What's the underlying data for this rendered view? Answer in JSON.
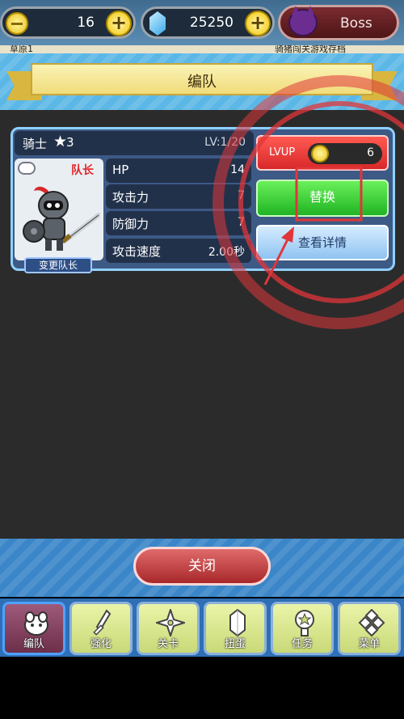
{
  "topbar": {
    "coins": "16",
    "gems": "25250",
    "boss_label": "Boss"
  },
  "background_strip": {
    "left_text": "草原1",
    "right_text": "骑猪闯关游戏存档"
  },
  "header": {
    "title": "编队"
  },
  "character": {
    "name": "骑士",
    "star_level": "3",
    "level": "LV:1/20",
    "leader_badge": "队长",
    "change_leader_label": "变更队长",
    "stats": [
      {
        "label": "HP",
        "value": "14"
      },
      {
        "label": "攻击力",
        "value": "7"
      },
      {
        "label": "防御力",
        "value": "7"
      },
      {
        "label": "攻击速度",
        "value": "2.00秒"
      }
    ]
  },
  "actions": {
    "lvup_label": "LVUP",
    "lvup_cost": "6",
    "replace_label": "替换",
    "detail_label": "查看详情"
  },
  "close_label": "关闭",
  "nav": {
    "tabs": [
      {
        "label": "编队",
        "icon": "formation-icon",
        "active": true
      },
      {
        "label": "强化",
        "icon": "sword-icon",
        "active": false
      },
      {
        "label": "关卡",
        "icon": "shuriken-icon",
        "active": false
      },
      {
        "label": "扭蛋",
        "icon": "crystal-icon",
        "active": false
      },
      {
        "label": "任务",
        "icon": "medal-icon",
        "active": false
      },
      {
        "label": "菜单",
        "icon": "diamond-grid-icon",
        "active": false
      }
    ]
  },
  "colors": {
    "panel_blue": "#5bb7e6",
    "replace_green": "#20b424",
    "lvup_red": "#d8282a",
    "highlight_red": "#e0363a"
  }
}
